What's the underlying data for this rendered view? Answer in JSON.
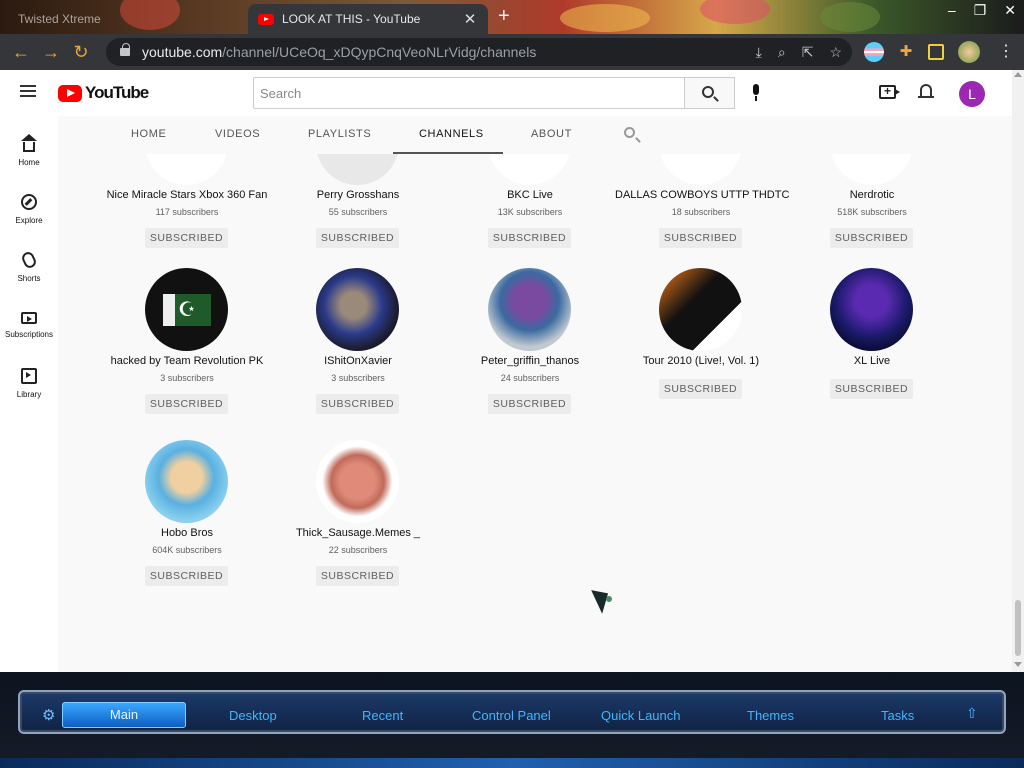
{
  "browser": {
    "tabs": [
      {
        "title": "Twisted Xtreme"
      },
      {
        "title": "LOOK AT THIS - YouTube"
      }
    ],
    "new_tab": "+",
    "url_host": "youtube.com",
    "url_path": "/channel/UCeOq_xDQypCnqVeoNLrVidg/channels"
  },
  "youtube": {
    "logo_text": "YouTube",
    "search_placeholder": "Search",
    "avatar_letter": "L",
    "sidebar": [
      {
        "label": "Home"
      },
      {
        "label": "Explore"
      },
      {
        "label": "Shorts"
      },
      {
        "label": "Subscriptions"
      },
      {
        "label": "Library"
      }
    ],
    "channel_tabs": [
      "HOME",
      "VIDEOS",
      "PLAYLISTS",
      "CHANNELS",
      "ABOUT"
    ],
    "active_tab": "CHANNELS",
    "subscribed_label": "SUBSCRIBED",
    "channels": [
      {
        "name": "Nice Miracle Stars Xbox 360 Fan",
        "subs": "117 subscribers"
      },
      {
        "name": "Perry Grosshans",
        "subs": "55 subscribers"
      },
      {
        "name": "BKC Live",
        "subs": "13K subscribers"
      },
      {
        "name": "DALLAS COWBOYS UTTP THDTC",
        "subs": "18 subscribers"
      },
      {
        "name": "Nerdrotic",
        "subs": "518K subscribers"
      },
      {
        "name": "hacked by Team Revolution PK",
        "subs": "3 subscribers"
      },
      {
        "name": "IShitOnXavier",
        "subs": "3 subscribers"
      },
      {
        "name": "Peter_griffin_thanos",
        "subs": "24 subscribers"
      },
      {
        "name": "Tour 2010 (Live!, Vol. 1)",
        "subs": ""
      },
      {
        "name": "XL Live",
        "subs": ""
      },
      {
        "name": "Hobo Bros",
        "subs": "604K subscribers"
      },
      {
        "name": "Thick_Sausage.Memes _",
        "subs": "22 subscribers"
      }
    ]
  },
  "taskbar": {
    "items": [
      "Main",
      "Desktop",
      "Recent",
      "Control Panel",
      "Quick Launch",
      "Themes",
      "Tasks"
    ],
    "accent": "#3fb6ff"
  }
}
